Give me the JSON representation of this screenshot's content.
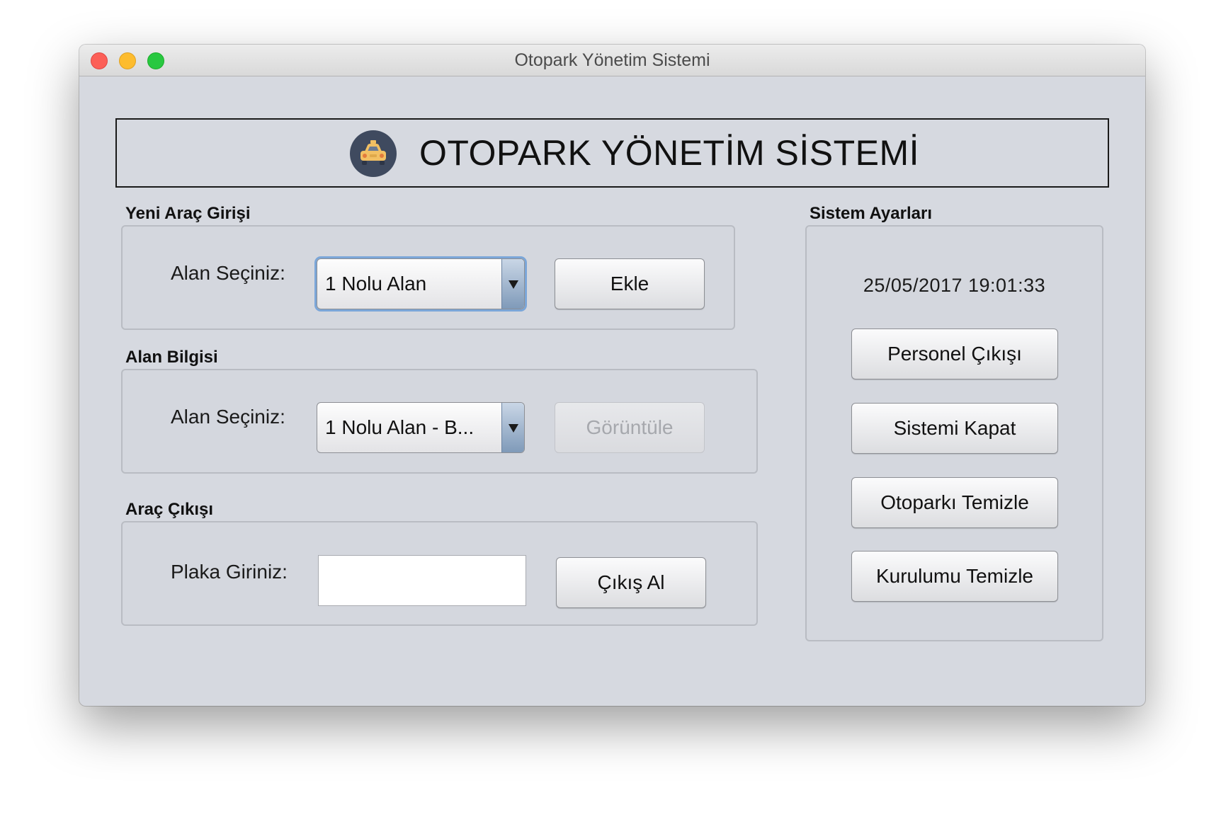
{
  "window": {
    "title": "Otopark Yönetim Sistemi"
  },
  "header": {
    "title": "OTOPARK YÖNETİM SİSTEMİ"
  },
  "new_vehicle": {
    "group_label": "Yeni Araç Girişi",
    "field_label": "Alan Seçiniz:",
    "combo_value": "1 Nolu Alan",
    "button_label": "Ekle"
  },
  "area_info": {
    "group_label": "Alan Bilgisi",
    "field_label": "Alan Seçiniz:",
    "combo_value": "1 Nolu Alan - B...",
    "button_label": "Görüntüle"
  },
  "vehicle_exit": {
    "group_label": "Araç Çıkışı",
    "field_label": "Plaka Giriniz:",
    "plate_value": "",
    "button_label": "Çıkış Al"
  },
  "settings": {
    "group_label": "Sistem Ayarları",
    "datetime": "25/05/2017 19:01:33",
    "buttons": [
      {
        "label": "Personel Çıkışı"
      },
      {
        "label": "Sistemi Kapat"
      },
      {
        "label": "Otoparkı Temizle"
      },
      {
        "label": "Kurulumu Temizle"
      }
    ]
  },
  "colors": {
    "window_bg": "#d6d9e0",
    "logo_circle": "#3f4a5f",
    "logo_car": "#f2c063",
    "combo_arrow": "#7f9ab9"
  },
  "icons": {
    "logo": "taxi-car-icon",
    "combo_arrow": "triangle-down-icon"
  }
}
